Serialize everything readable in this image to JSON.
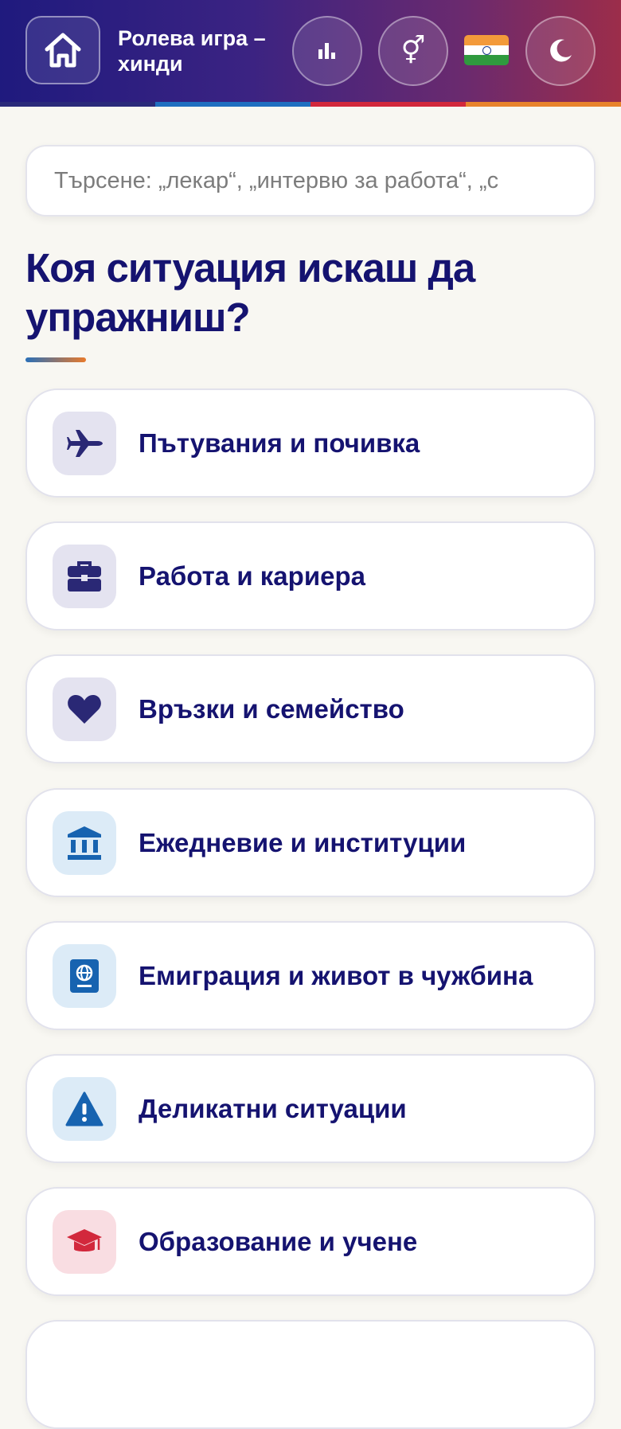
{
  "header": {
    "title": "Ролева игра – хинди",
    "home_icon": "home-icon",
    "stats_icon": "bar-chart-icon",
    "gender_icon": "gender-icon",
    "flag": "india-flag",
    "theme_icon": "moon-icon",
    "stripe_colors": [
      "#2a2a7a",
      "#1f6fc0",
      "#d2283c",
      "#e8832c"
    ]
  },
  "search": {
    "placeholder": "Търсене: „лекар“, „интервю за работа“, „с"
  },
  "heading": "Коя ситуация искаш да упражниш?",
  "categories": [
    {
      "label": "Пътувания и почивка",
      "icon": "airplane-icon",
      "icon_bg": "#e4e3f0",
      "icon_color": "#2a2875"
    },
    {
      "label": "Работа и кариера",
      "icon": "briefcase-icon",
      "icon_bg": "#e4e3f0",
      "icon_color": "#2a2875"
    },
    {
      "label": "Връзки и семейство",
      "icon": "heart-icon",
      "icon_bg": "#e4e3f0",
      "icon_color": "#2a2875"
    },
    {
      "label": "Ежедневие и институции",
      "icon": "bank-icon",
      "icon_bg": "#dcebf7",
      "icon_color": "#1763b0"
    },
    {
      "label": "Емиграция и живот в чужбина",
      "icon": "passport-icon",
      "icon_bg": "#dcebf7",
      "icon_color": "#1763b0"
    },
    {
      "label": "Деликатни ситуации",
      "icon": "warning-icon",
      "icon_bg": "#dcebf7",
      "icon_color": "#1763b0"
    },
    {
      "label": "Образование и учене",
      "icon": "graduation-cap-icon",
      "icon_bg": "#f9dde2",
      "icon_color": "#d2283c"
    }
  ]
}
